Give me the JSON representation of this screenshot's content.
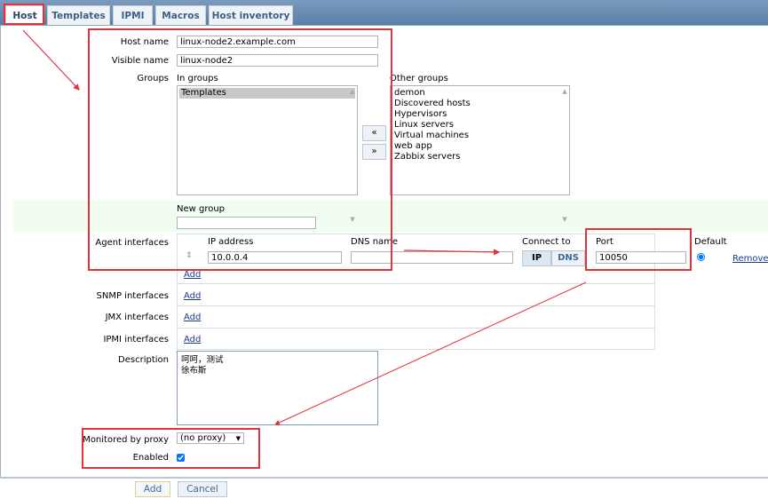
{
  "tabs": [
    {
      "label": "Host",
      "active": true
    },
    {
      "label": "Templates"
    },
    {
      "label": "IPMI"
    },
    {
      "label": "Macros"
    },
    {
      "label": "Host inventory"
    }
  ],
  "form": {
    "host_name": {
      "label": "Host name",
      "value": "linux-node2.example.com"
    },
    "visible_name": {
      "label": "Visible name",
      "value": "linux-node2"
    },
    "groups": {
      "label": "Groups",
      "in_groups_label": "In groups",
      "in_groups": [
        "Templates"
      ],
      "other_groups_label": "Other groups",
      "other_groups": [
        "demon",
        "Discovered hosts",
        "Hypervisors",
        "Linux servers",
        "Virtual machines",
        "web app",
        "Zabbix servers"
      ],
      "move_left": "«",
      "move_right": "»"
    },
    "new_group": {
      "label": "New group",
      "value": ""
    },
    "agent_interfaces": {
      "label": "Agent interfaces",
      "headers": {
        "ip": "IP address",
        "dns": "DNS name",
        "connect": "Connect to",
        "port": "Port",
        "default": "Default"
      },
      "row": {
        "ip": "10.0.0.4",
        "dns": "",
        "connect_ip": "IP",
        "connect_dns": "DNS",
        "connect_selected": "IP",
        "port": "10050",
        "remove": "Remove"
      },
      "add": "Add"
    },
    "snmp": {
      "label": "SNMP interfaces",
      "add": "Add"
    },
    "jmx": {
      "label": "JMX interfaces",
      "add": "Add"
    },
    "ipmi": {
      "label": "IPMI interfaces",
      "add": "Add"
    },
    "description": {
      "label": "Description",
      "value": "呵呵，测试\n徐布斯"
    },
    "proxy": {
      "label": "Monitored by proxy",
      "value": "(no proxy)"
    },
    "enabled": {
      "label": "Enabled",
      "checked": true
    }
  },
  "buttons": {
    "add": "Add",
    "cancel": "Cancel"
  },
  "colors": {
    "annotation": "#e0333b",
    "tab_bar": "#6b8db3"
  }
}
